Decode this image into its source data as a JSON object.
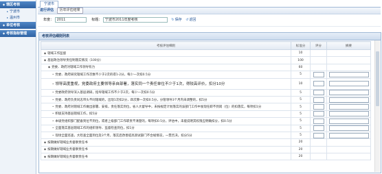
{
  "sidebar": {
    "groups": [
      {
        "label": "辖区考核",
        "items": [
          {
            "label": "宁波市"
          },
          {
            "label": "温州市"
          }
        ]
      },
      {
        "label": "单位考核",
        "items": []
      },
      {
        "label": "考核指标管理",
        "items": []
      }
    ]
  },
  "tabs": [
    {
      "label": "宁波市"
    }
  ],
  "breadcrumb": {
    "current": "进行评估",
    "sub": "历年评估结果"
  },
  "filters": {
    "year_label": "年度：",
    "year_value": "2011",
    "title_label": "标题：",
    "title_value": "宁波市2011年度考核",
    "save_label": "保存",
    "back_label": "返回"
  },
  "panel": {
    "title": "考核评估细则列表"
  },
  "table": {
    "headers": [
      "考核评估细则",
      "标准分",
      "评分",
      "摘要"
    ],
    "rows": [
      {
        "text": "辖域工作监督",
        "score": "10",
        "level": 1
      },
      {
        "text": "基层政治领导责任制落实情况（100分）",
        "score": "100",
        "level": 1
      },
      {
        "text": "党委、政府对辖域工作领导有力",
        "score": "60",
        "level": 2
      },
      {
        "text": "党委、政府研究辖域工作次数不少于2次的得1-2分，每少一次扣0.5分",
        "score": "5",
        "level": 3
      },
      {
        "text": "领导高度重视，党委政府主要领导亲自部署，落实同一个责任单位不少于1次，得较高评价，扣分10分",
        "score": "10",
        "level": 3,
        "big": true
      },
      {
        "text": "党委政府领导深入基层调研，指导辖域工作不少于2次，每少一次扣0.5分",
        "score": "5",
        "level": 3
      },
      {
        "text": "党委、政府负责同志带头不同辖域的，出现1次扣2分，四次算一次扣0.5分，分管领导3个月内未调整的，扣5分",
        "score": "5",
        "level": 3
      },
      {
        "text": "党委、政府对辖域工作做出部署、安排，责任落实到位，省人大督导中，未按规定计划落实的该部门工作中发现任职不到岗（位）的扣落实，每项扣1分",
        "score": "5",
        "level": 3
      },
      {
        "text": "积极支持基层辖域工作，扣5分",
        "score": "5",
        "level": 3
      },
      {
        "text": "本级党组织部门配备到位不到位，或者上级部门工作职责不清楚的，每项扣0.5分，评估中，未能说明其权限应明确扣分，扣0.5分",
        "score": "5",
        "level": 3
      },
      {
        "text": "全面落实基层辖域工作的组织领导、监督检查到位，扣1分",
        "score": "5",
        "level": 3
      },
      {
        "text": "现场全面巡查，大检查全面到位及3个月，落实后改善提高测试部门不合规情况，一票否决，扣分5分",
        "score": "5",
        "level": 3
      },
      {
        "text": "按期做好辖域业务督察责任书",
        "score": "20",
        "level": 1
      },
      {
        "text": "按期做好辖域业务督察责任书",
        "score": "20",
        "level": 1
      },
      {
        "text": "按期做好辖域业务督察责任书",
        "score": "20",
        "level": 1
      }
    ]
  },
  "colors": {
    "accent": "#2f62a3",
    "link": "#1c4f94"
  }
}
